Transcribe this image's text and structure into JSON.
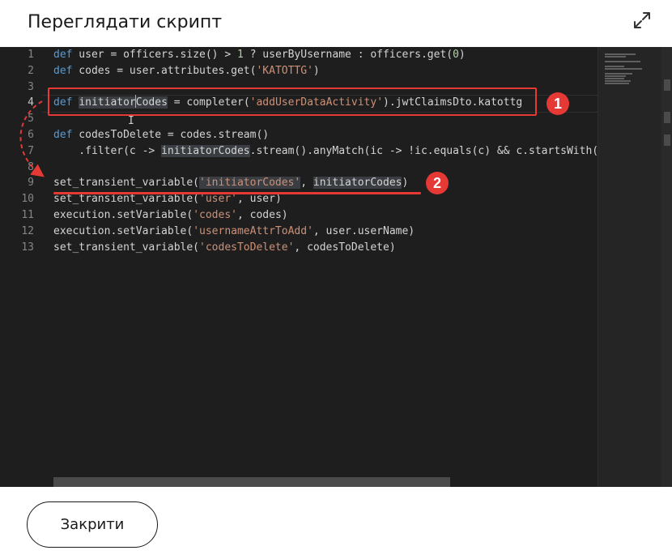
{
  "dialog": {
    "title": "Переглядати скрипт",
    "close_label": "Закрити"
  },
  "editor": {
    "active_line": 4,
    "line_numbers": [
      "1",
      "2",
      "3",
      "4",
      "5",
      "6",
      "7",
      "8",
      "9",
      "10",
      "11",
      "12",
      "13"
    ],
    "lines": [
      [
        {
          "t": "def",
          "c": "kw"
        },
        {
          "t": " user = officers.size() > "
        },
        {
          "t": "1",
          "c": "num"
        },
        {
          "t": " ? userByUsername : officers.get("
        },
        {
          "t": "0",
          "c": "num"
        },
        {
          "t": ")"
        }
      ],
      [
        {
          "t": "def",
          "c": "kw"
        },
        {
          "t": " codes = user.attributes.get("
        },
        {
          "t": "'KATOTTG'",
          "c": "str"
        },
        {
          "t": ")"
        }
      ],
      [],
      [
        {
          "t": "def",
          "c": "kw"
        },
        {
          "t": " "
        },
        {
          "t": "initiator",
          "c": "hl"
        },
        {
          "cursor": true
        },
        {
          "t": "Codes",
          "c": "hl"
        },
        {
          "t": " = completer("
        },
        {
          "t": "'addUserDataActivity'",
          "c": "str"
        },
        {
          "t": ").jwtClaimsDto.katottg"
        }
      ],
      [],
      [
        {
          "t": "def",
          "c": "kw"
        },
        {
          "t": " codesToDelete = codes.stream()"
        }
      ],
      [
        {
          "t": "    .filter(c -> "
        },
        {
          "t": "initiatorCodes",
          "c": "hl"
        },
        {
          "t": ".stream().anyMatch(ic -> !ic.equals(c) && c.startsWith(ic)))"
        }
      ],
      [],
      [
        {
          "t": "set_transient_variable("
        },
        {
          "t": "'initiatorCodes'",
          "c": "str hl"
        },
        {
          "t": ", "
        },
        {
          "t": "initiatorCodes",
          "c": "hl"
        },
        {
          "t": ")"
        }
      ],
      [
        {
          "t": "set_transient_variable("
        },
        {
          "t": "'user'",
          "c": "str"
        },
        {
          "t": ", user)"
        }
      ],
      [
        {
          "t": "execution.setVariable("
        },
        {
          "t": "'codes'",
          "c": "str"
        },
        {
          "t": ", codes)"
        }
      ],
      [
        {
          "t": "execution.setVariable("
        },
        {
          "t": "'usernameAttrToAdd'",
          "c": "str"
        },
        {
          "t": ", user.userName)"
        }
      ],
      [
        {
          "t": "set_transient_variable("
        },
        {
          "t": "'codesToDelete'",
          "c": "str"
        },
        {
          "t": ", codesToDelete)"
        }
      ]
    ]
  },
  "annotations": {
    "badge_1": "1",
    "badge_2": "2",
    "color": "#e53935"
  },
  "icons": {
    "expand": "expand-arrows-icon"
  }
}
